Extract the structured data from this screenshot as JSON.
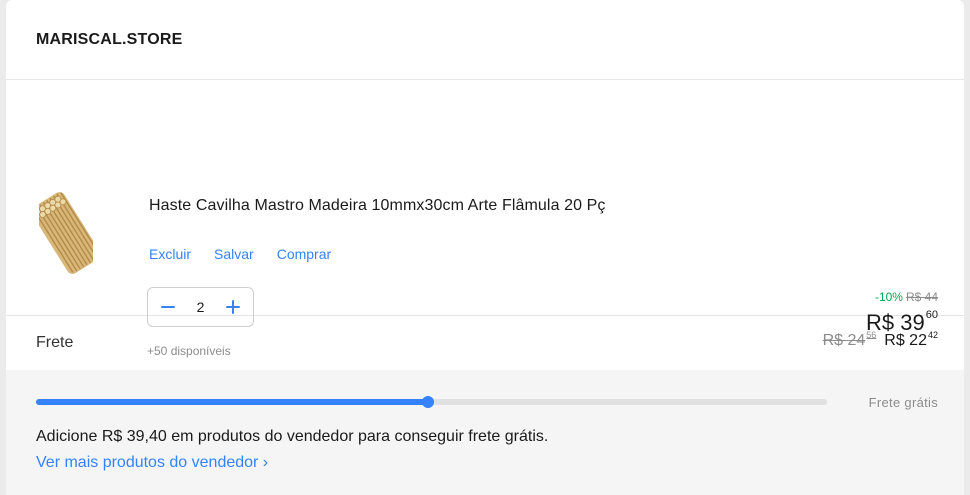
{
  "seller": {
    "name": "MARISCAL.STORE"
  },
  "item": {
    "title": "Haste Cavilha Mastro Madeira 10mmx30cm Arte Flâmula 20 Pç",
    "actions": {
      "delete": "Excluir",
      "save": "Salvar",
      "buy": "Comprar"
    },
    "quantity": {
      "minus_icon": "minus-icon",
      "value": "2",
      "plus_icon": "plus-icon"
    },
    "availability": "+50 disponíveis",
    "discount": "-10%",
    "old_price": "R$ 44",
    "price": {
      "whole": "R$ 39",
      "cents": "60"
    }
  },
  "shipping": {
    "label": "Frete",
    "old": {
      "whole": "R$ 24",
      "cents": "56"
    },
    "new": {
      "whole": "R$ 22",
      "cents": "42"
    }
  },
  "free_shipping": {
    "progress_percent": 49.6,
    "label": "Frete grátis",
    "message": "Adicione R$ 39,40 em produtos do vendedor para conseguir frete grátis.",
    "link": "Ver mais produtos do vendedor ›"
  },
  "colors": {
    "accent": "#3483fa",
    "discount": "#00a650",
    "muted": "#8c8c8c"
  }
}
